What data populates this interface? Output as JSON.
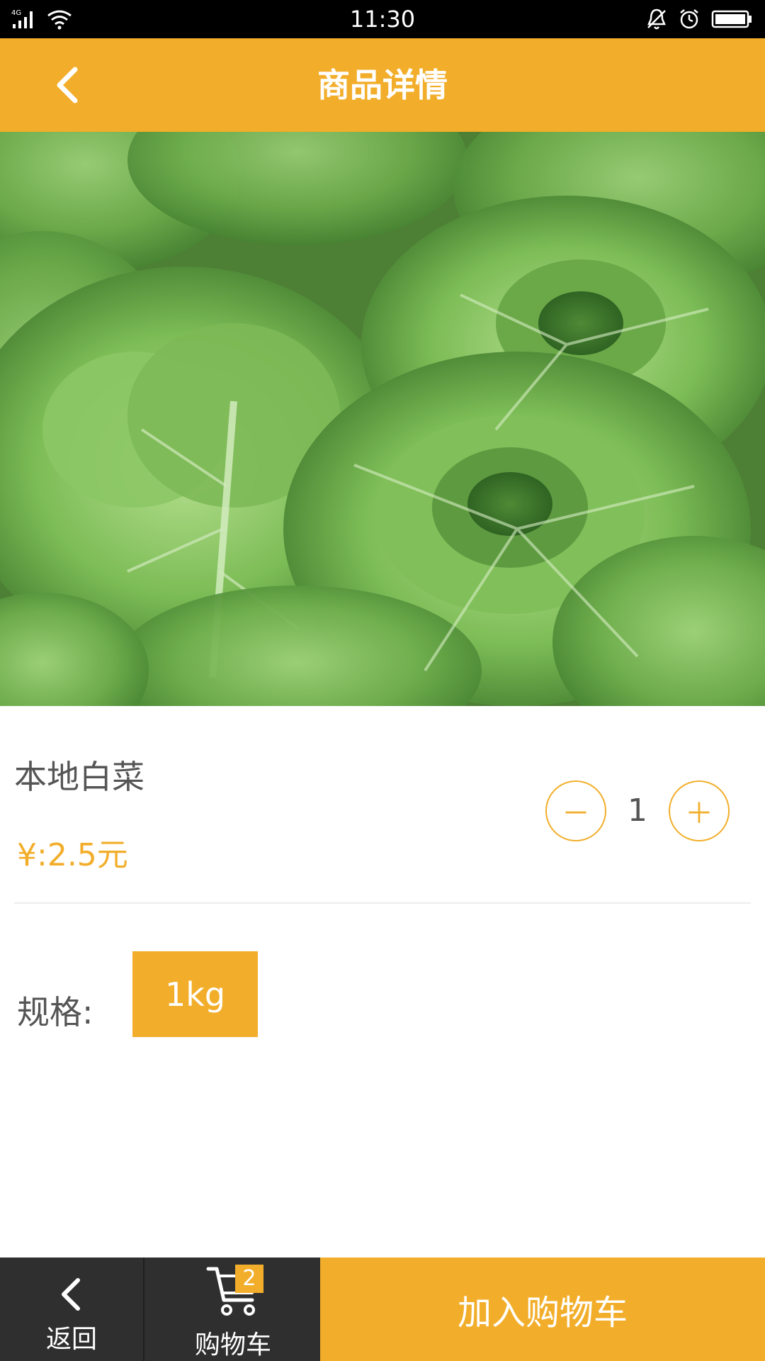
{
  "status_bar": {
    "network": "4G",
    "time": "11:30"
  },
  "header": {
    "title": "商品详情"
  },
  "product": {
    "image_icon": "cabbage-photo",
    "name": "本地白菜",
    "price": "¥:2.5元",
    "quantity": "1",
    "minus_label": "－",
    "plus_label": "＋"
  },
  "spec": {
    "label": "规格:",
    "selected": "1kg"
  },
  "bottom_nav": {
    "back_label": "返回",
    "cart_label": "购物车",
    "cart_count": "2",
    "add_to_cart_label": "加入购物车"
  },
  "colors": {
    "accent": "#f2ae2a",
    "bottom_bar": "#2f2f2f",
    "text": "#555555"
  }
}
